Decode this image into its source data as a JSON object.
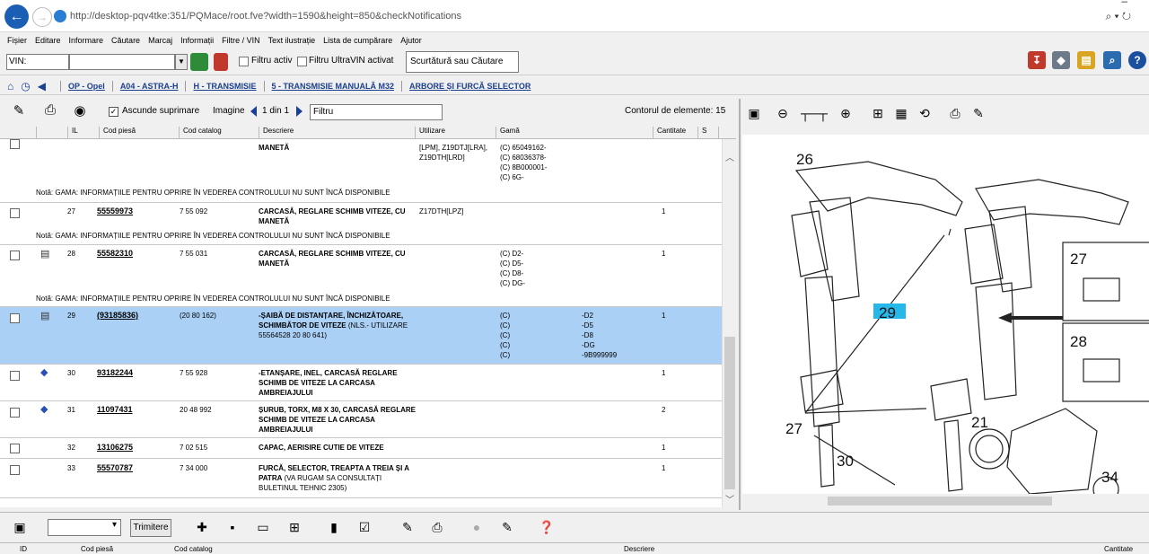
{
  "browser": {
    "url": "http://desktop-pqv4tke:351/PQMace/root.fve?width=1590&height=850&checkNotifications",
    "search_ctrl": "⌕ ▾ ↻"
  },
  "menu": [
    "Fișier",
    "Editare",
    "Informare",
    "Căutare",
    "Marcaj",
    "Informații",
    "Filtre / VIN",
    "Text ilustrație",
    "Lista de cumpărare",
    "Ajutor"
  ],
  "vin": {
    "label": "VIN:",
    "filter_active": "Filtru activ",
    "filter_ultravin": "Filtru UltraVIN activat",
    "shortcut_placeholder": "Scurtătură sau Căutare"
  },
  "breadcrumb": [
    "OP - Opel",
    "A04 - ASTRA-H",
    "H - TRANSMISIE",
    "5 - TRANSMISIE MANUALĂ M32",
    "ARBORE ȘI FURCĂ SELECTOR"
  ],
  "left_toolbar": {
    "hide_deleted": "Ascunde suprimare",
    "image_label": "Imagine",
    "image_count": "1 din 1",
    "filter_value": "Filtru",
    "counter": "Contorul de elemente: 15"
  },
  "columns": {
    "il": "IL",
    "part_code": "Cod piesă",
    "catalog_code": "Cod catalog",
    "description": "Descriere",
    "usage": "Utilizare",
    "range": "Gamă",
    "qty": "Cantitate",
    "s": "S"
  },
  "partial_row": {
    "desc": "MANETĂ",
    "usage": "[LPM], Z19DTJ[LRA], Z19DTH[LRD]",
    "range": [
      "(C) 65049162-",
      "(C) 68036378-",
      "(C) 8B000001-",
      "(C) 6G-"
    ]
  },
  "note_text": "Notă: GAMA: INFORMAȚIILE PENTRU OPRIRE ÎN VEDEREA CONTROLULUI NU SUNT ÎNCĂ DISPONIBILE",
  "rows": [
    {
      "il": "27",
      "code": "55559973",
      "catalog": "7 55 092",
      "desc": "CARCASĂ, REGLARE SCHIMB VITEZE, CU MANETĂ",
      "usage": "Z17DTH[LPZ]",
      "range": [],
      "range2": [],
      "qty": "1"
    },
    {
      "il": "28",
      "code": "55582310",
      "catalog": "7 55 031",
      "desc": "CARCASĂ, REGLARE SCHIMB VITEZE, CU MANETĂ",
      "usage": "",
      "range": [
        "(C) D2-",
        "(C) D5-",
        "(C) D8-",
        "(C) DG-"
      ],
      "range2": [],
      "qty": "1"
    },
    {
      "il": "29",
      "code": "(93185836)",
      "catalog": "(20 80 162)",
      "desc": "-ȘAIBĂ DE DISTANȚARE, ÎNCHIZĂTOARE, SCHIMBĂTOR DE VITEZE",
      "desc_extra": "(NLS.- UTILIZARE 55564528 20 80 641)",
      "usage": "",
      "range": [
        "(C)",
        "(C)",
        "(C)",
        "(C)",
        "(C)"
      ],
      "range2": [
        "-D2",
        "-D5",
        "-D8",
        "-DG",
        "-9B999999"
      ],
      "qty": "1"
    },
    {
      "il": "30",
      "code": "93182244",
      "catalog": "7 55 928",
      "desc": "-ETANȘARE, INEL, CARCASĂ REGLARE SCHIMB DE VITEZE LA CARCASA AMBREIAJULUI",
      "usage": "",
      "range": [],
      "range2": [],
      "qty": "1"
    },
    {
      "il": "31",
      "code": "11097431",
      "catalog": "20 48 992",
      "desc": "ȘURUB, TORX, M8 X 30, CARCASĂ REGLARE SCHIMB DE VITEZE LA CARCASA AMBREIAJULUI",
      "usage": "",
      "range": [],
      "range2": [],
      "qty": "2"
    },
    {
      "il": "32",
      "code": "13106275",
      "catalog": "7 02 515",
      "desc": "CAPAC, AERISIRE CUTIE DE VITEZE",
      "usage": "",
      "range": [],
      "range2": [],
      "qty": "1"
    },
    {
      "il": "33",
      "code": "55570787",
      "catalog": "7 34 000",
      "desc": "FURCĂ, SELECTOR, TREAPTA A TREIA ȘI A PATRA",
      "desc_extra": "(VA RUGAM SA CONSULTAȚI BULETINUL TEHNIC 2305)",
      "usage": "",
      "range": [],
      "range2": [],
      "qty": "1"
    }
  ],
  "drawing": {
    "callouts": [
      "26",
      "27",
      "28",
      "29",
      "27",
      "21",
      "30",
      "34"
    ]
  },
  "bottom": {
    "send": "Trimitere",
    "columns": [
      "ID",
      "Cod piesă",
      "Cod catalog",
      "Descriere",
      "Cantitate"
    ]
  }
}
